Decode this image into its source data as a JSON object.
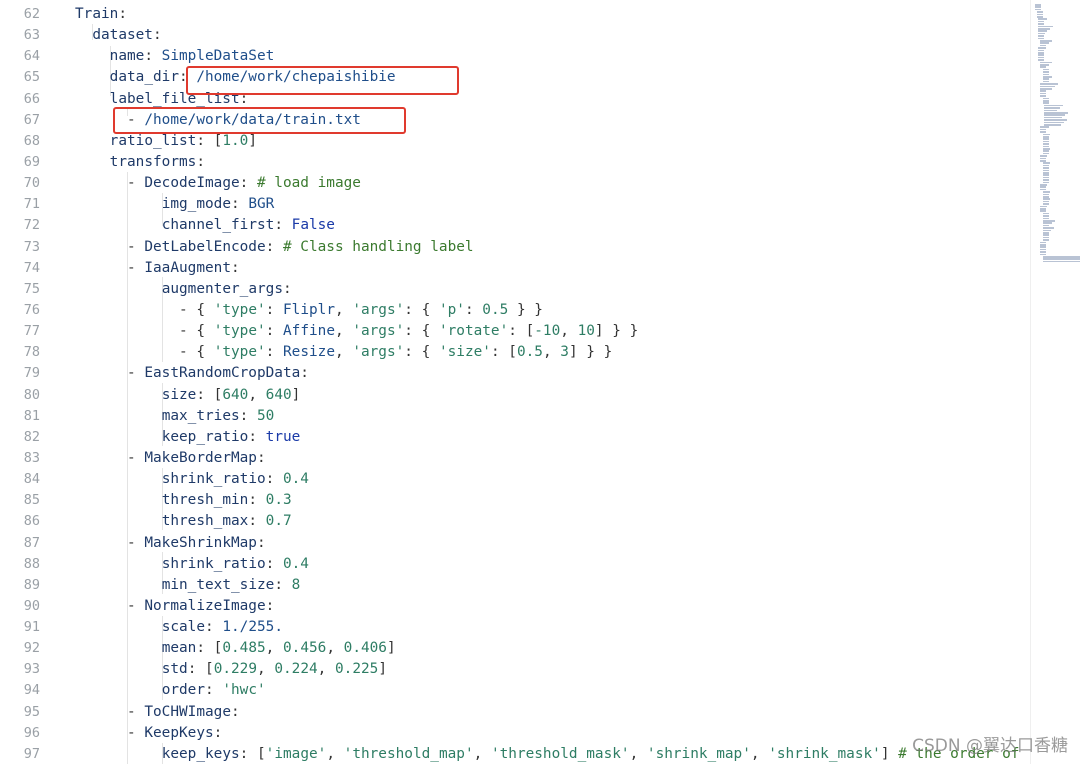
{
  "lines": [
    {
      "n": "62",
      "i": 0,
      "t": [
        [
          "k",
          "Train"
        ],
        [
          "p",
          ":"
        ]
      ]
    },
    {
      "n": "63",
      "i": 1,
      "t": [
        [
          "k",
          "dataset"
        ],
        [
          "p",
          ":"
        ]
      ]
    },
    {
      "n": "64",
      "i": 2,
      "t": [
        [
          "k",
          "name"
        ],
        [
          "p",
          ": "
        ],
        [
          "s",
          "SimpleDataSet"
        ]
      ]
    },
    {
      "n": "65",
      "i": 2,
      "t": [
        [
          "k",
          "data_dir"
        ],
        [
          "p",
          ": "
        ],
        [
          "s",
          "/home/work/chepaishibie"
        ]
      ]
    },
    {
      "n": "66",
      "i": 2,
      "t": [
        [
          "k",
          "label_file_list"
        ],
        [
          "p",
          ":"
        ]
      ]
    },
    {
      "n": "67",
      "i": 3,
      "t": [
        [
          "p",
          "- "
        ],
        [
          "s",
          "/home/work/data/train.txt"
        ]
      ]
    },
    {
      "n": "68",
      "i": 2,
      "t": [
        [
          "k",
          "ratio_list"
        ],
        [
          "p",
          ": ["
        ],
        [
          "n",
          "1.0"
        ],
        [
          "p",
          "]"
        ]
      ]
    },
    {
      "n": "69",
      "i": 2,
      "t": [
        [
          "k",
          "transforms"
        ],
        [
          "p",
          ":"
        ]
      ]
    },
    {
      "n": "70",
      "i": 3,
      "t": [
        [
          "p",
          "- "
        ],
        [
          "k",
          "DecodeImage"
        ],
        [
          "p",
          ": "
        ],
        [
          "c",
          "# load image"
        ]
      ]
    },
    {
      "n": "71",
      "i": 5,
      "t": [
        [
          "k",
          "img_mode"
        ],
        [
          "p",
          ": "
        ],
        [
          "s",
          "BGR"
        ]
      ]
    },
    {
      "n": "72",
      "i": 5,
      "t": [
        [
          "k",
          "channel_first"
        ],
        [
          "p",
          ": "
        ],
        [
          "b",
          "False"
        ]
      ]
    },
    {
      "n": "73",
      "i": 3,
      "t": [
        [
          "p",
          "- "
        ],
        [
          "k",
          "DetLabelEncode"
        ],
        [
          "p",
          ": "
        ],
        [
          "c",
          "# Class handling label"
        ]
      ]
    },
    {
      "n": "74",
      "i": 3,
      "t": [
        [
          "p",
          "- "
        ],
        [
          "k",
          "IaaAugment"
        ],
        [
          "p",
          ":"
        ]
      ]
    },
    {
      "n": "75",
      "i": 5,
      "t": [
        [
          "k",
          "augmenter_args"
        ],
        [
          "p",
          ":"
        ]
      ]
    },
    {
      "n": "76",
      "i": 6,
      "t": [
        [
          "p",
          "- { "
        ],
        [
          "str",
          "'type'"
        ],
        [
          "p",
          ": "
        ],
        [
          "s",
          "Fliplr"
        ],
        [
          "p",
          ", "
        ],
        [
          "str",
          "'args'"
        ],
        [
          "p",
          ": { "
        ],
        [
          "str",
          "'p'"
        ],
        [
          "p",
          ": "
        ],
        [
          "n",
          "0.5"
        ],
        [
          "p",
          " } }"
        ]
      ]
    },
    {
      "n": "77",
      "i": 6,
      "t": [
        [
          "p",
          "- { "
        ],
        [
          "str",
          "'type'"
        ],
        [
          "p",
          ": "
        ],
        [
          "s",
          "Affine"
        ],
        [
          "p",
          ", "
        ],
        [
          "str",
          "'args'"
        ],
        [
          "p",
          ": { "
        ],
        [
          "str",
          "'rotate'"
        ],
        [
          "p",
          ": ["
        ],
        [
          "n",
          "-10"
        ],
        [
          "p",
          ", "
        ],
        [
          "n",
          "10"
        ],
        [
          "p",
          "] } }"
        ]
      ]
    },
    {
      "n": "78",
      "i": 6,
      "t": [
        [
          "p",
          "- { "
        ],
        [
          "str",
          "'type'"
        ],
        [
          "p",
          ": "
        ],
        [
          "s",
          "Resize"
        ],
        [
          "p",
          ", "
        ],
        [
          "str",
          "'args'"
        ],
        [
          "p",
          ": { "
        ],
        [
          "str",
          "'size'"
        ],
        [
          "p",
          ": ["
        ],
        [
          "n",
          "0.5"
        ],
        [
          "p",
          ", "
        ],
        [
          "n",
          "3"
        ],
        [
          "p",
          "] } }"
        ]
      ]
    },
    {
      "n": "79",
      "i": 3,
      "t": [
        [
          "p",
          "- "
        ],
        [
          "k",
          "EastRandomCropData"
        ],
        [
          "p",
          ":"
        ]
      ]
    },
    {
      "n": "80",
      "i": 5,
      "t": [
        [
          "k",
          "size"
        ],
        [
          "p",
          ": ["
        ],
        [
          "n",
          "640"
        ],
        [
          "p",
          ", "
        ],
        [
          "n",
          "640"
        ],
        [
          "p",
          "]"
        ]
      ]
    },
    {
      "n": "81",
      "i": 5,
      "t": [
        [
          "k",
          "max_tries"
        ],
        [
          "p",
          ": "
        ],
        [
          "n",
          "50"
        ]
      ]
    },
    {
      "n": "82",
      "i": 5,
      "t": [
        [
          "k",
          "keep_ratio"
        ],
        [
          "p",
          ": "
        ],
        [
          "b",
          "true"
        ]
      ]
    },
    {
      "n": "83",
      "i": 3,
      "t": [
        [
          "p",
          "- "
        ],
        [
          "k",
          "MakeBorderMap"
        ],
        [
          "p",
          ":"
        ]
      ]
    },
    {
      "n": "84",
      "i": 5,
      "t": [
        [
          "k",
          "shrink_ratio"
        ],
        [
          "p",
          ": "
        ],
        [
          "n",
          "0.4"
        ]
      ]
    },
    {
      "n": "85",
      "i": 5,
      "t": [
        [
          "k",
          "thresh_min"
        ],
        [
          "p",
          ": "
        ],
        [
          "n",
          "0.3"
        ]
      ]
    },
    {
      "n": "86",
      "i": 5,
      "t": [
        [
          "k",
          "thresh_max"
        ],
        [
          "p",
          ": "
        ],
        [
          "n",
          "0.7"
        ]
      ]
    },
    {
      "n": "87",
      "i": 3,
      "t": [
        [
          "p",
          "- "
        ],
        [
          "k",
          "MakeShrinkMap"
        ],
        [
          "p",
          ":"
        ]
      ]
    },
    {
      "n": "88",
      "i": 5,
      "t": [
        [
          "k",
          "shrink_ratio"
        ],
        [
          "p",
          ": "
        ],
        [
          "n",
          "0.4"
        ]
      ]
    },
    {
      "n": "89",
      "i": 5,
      "t": [
        [
          "k",
          "min_text_size"
        ],
        [
          "p",
          ": "
        ],
        [
          "n",
          "8"
        ]
      ]
    },
    {
      "n": "90",
      "i": 3,
      "t": [
        [
          "p",
          "- "
        ],
        [
          "k",
          "NormalizeImage"
        ],
        [
          "p",
          ":"
        ]
      ]
    },
    {
      "n": "91",
      "i": 5,
      "t": [
        [
          "k",
          "scale"
        ],
        [
          "p",
          ": "
        ],
        [
          "s",
          "1./255."
        ]
      ]
    },
    {
      "n": "92",
      "i": 5,
      "t": [
        [
          "k",
          "mean"
        ],
        [
          "p",
          ": ["
        ],
        [
          "n",
          "0.485"
        ],
        [
          "p",
          ", "
        ],
        [
          "n",
          "0.456"
        ],
        [
          "p",
          ", "
        ],
        [
          "n",
          "0.406"
        ],
        [
          "p",
          "]"
        ]
      ]
    },
    {
      "n": "93",
      "i": 5,
      "t": [
        [
          "k",
          "std"
        ],
        [
          "p",
          ": ["
        ],
        [
          "n",
          "0.229"
        ],
        [
          "p",
          ", "
        ],
        [
          "n",
          "0.224"
        ],
        [
          "p",
          ", "
        ],
        [
          "n",
          "0.225"
        ],
        [
          "p",
          "]"
        ]
      ]
    },
    {
      "n": "94",
      "i": 5,
      "t": [
        [
          "k",
          "order"
        ],
        [
          "p",
          ": "
        ],
        [
          "str",
          "'hwc'"
        ]
      ]
    },
    {
      "n": "95",
      "i": 3,
      "t": [
        [
          "p",
          "- "
        ],
        [
          "k",
          "ToCHWImage"
        ],
        [
          "p",
          ":"
        ]
      ]
    },
    {
      "n": "96",
      "i": 3,
      "t": [
        [
          "p",
          "- "
        ],
        [
          "k",
          "KeepKeys"
        ],
        [
          "p",
          ":"
        ]
      ]
    },
    {
      "n": "97",
      "i": 5,
      "t": [
        [
          "k",
          "keep_keys"
        ],
        [
          "p",
          ": ["
        ],
        [
          "str",
          "'image'"
        ],
        [
          "p",
          ", "
        ],
        [
          "str",
          "'threshold_map'"
        ],
        [
          "p",
          ", "
        ],
        [
          "str",
          "'threshold_mask'"
        ],
        [
          "p",
          ", "
        ],
        [
          "str",
          "'shrink_map'"
        ],
        [
          "p",
          ", "
        ],
        [
          "str",
          "'shrink_mask'"
        ],
        [
          "p",
          "] "
        ],
        [
          "c",
          "# the order of"
        ]
      ]
    }
  ],
  "watermark": "CSDN @翼达口香糖",
  "colors": {
    "highlight": "#e03a2e",
    "line_number": "#9aa0a6",
    "comment": "#3b7a2f",
    "boolean": "#1a3aa8"
  }
}
